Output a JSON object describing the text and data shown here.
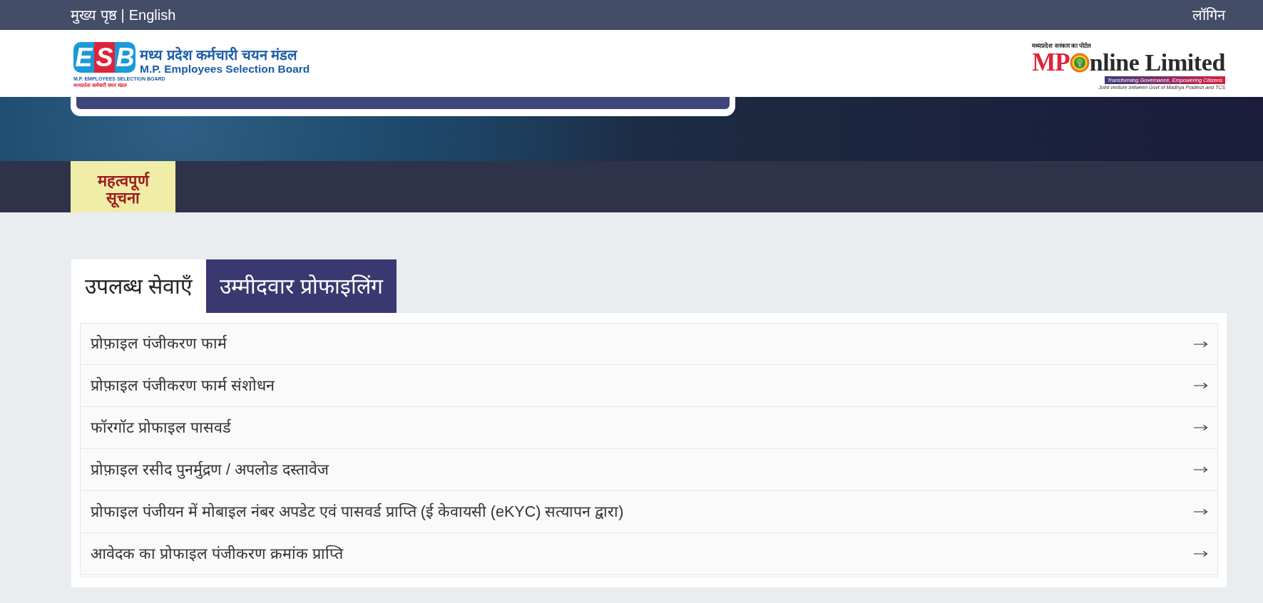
{
  "top_bar": {
    "links": [
      {
        "label": "मुख्य पृष्ठ"
      },
      {
        "label": "English"
      }
    ],
    "separator": "|",
    "login": "लॉगिन"
  },
  "header": {
    "esb_logo": {
      "letters": [
        {
          "text": "E",
          "color": "#1b9ad8"
        },
        {
          "text": "S",
          "color": "#e0233c"
        },
        {
          "text": "B",
          "color": "#1b9ad8"
        }
      ],
      "caption_en": "M.P. EMPLOYEES SELECTION BOARD",
      "caption_hi": "मध्यप्रदेश कर्मचारी चयन मंडल",
      "name_hi": "मध्य प्रदेश कर्मचारी चयन मंडल",
      "name_en": "M.P. Employees Selection Board"
    },
    "mponline_logo": {
      "overline": "मध्यप्रदेश सरकार का पोर्टल",
      "mark": "MP",
      "wordmark": "nline Limited",
      "tagline": "Transforming Governance, Empowering Citizens",
      "footnote": "Joint venture between Govt of Madhya Pradesh and TCS"
    }
  },
  "notice_tab": {
    "label": "महत्वपूर्ण सूचना"
  },
  "tabs": [
    {
      "label": "उपलब्ध सेवाएँ",
      "selected": false
    },
    {
      "label": "उम्मीदवार प्रोफाइलिंग",
      "selected": true
    }
  ],
  "services": [
    {
      "label": "प्रोफ़ाइल पंजीकरण फार्म"
    },
    {
      "label": "प्रोफ़ाइल पंजीकरण फार्म संशोधन"
    },
    {
      "label": "फॉरगॉट प्रोफाइल पासवर्ड"
    },
    {
      "label": "प्रोफ़ाइल रसीद पुनर्मुद्रण / अपलोड दस्तावेज"
    },
    {
      "label": "प्रोफाइल पंजीयन में मोबाइल नंबर अपडेट एवं पासवर्ड प्राप्ति (ई केवायसी (eKYC) सत्यापन द्वारा)"
    },
    {
      "label": "आवेदक का प्रोफाइल पंजीकरण क्रमांक प्राप्ति"
    }
  ]
}
